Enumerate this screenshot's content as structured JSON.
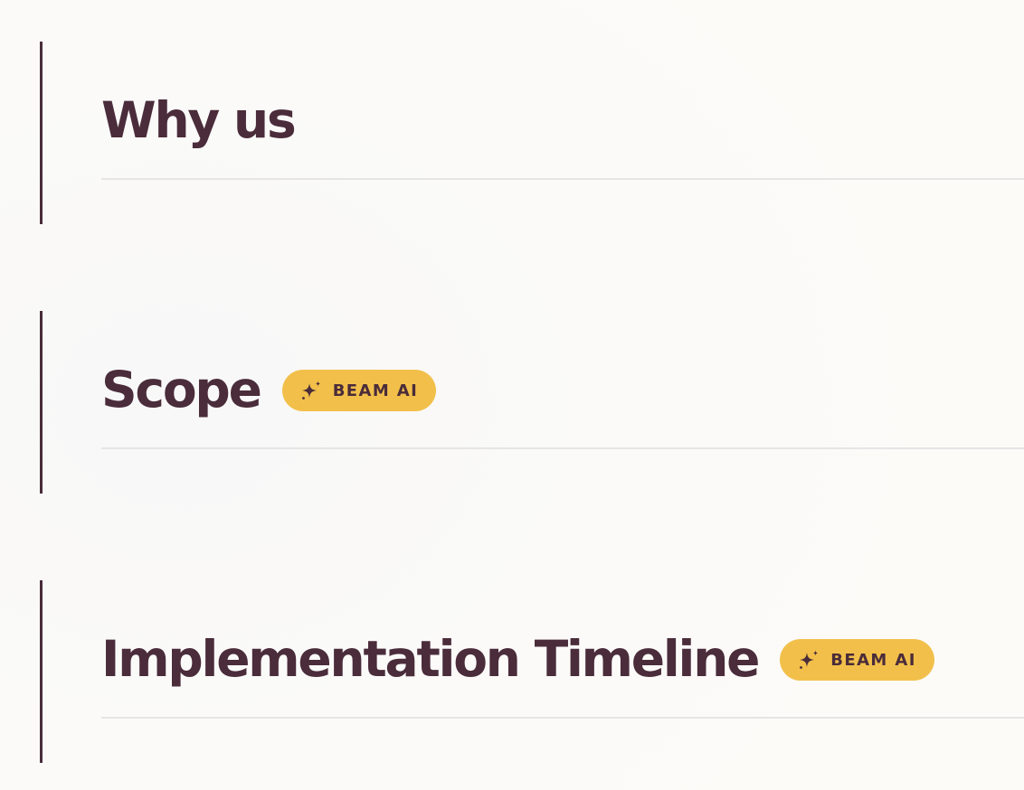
{
  "sections": [
    {
      "title": "Why us",
      "badge": null
    },
    {
      "title": "Scope",
      "badge": {
        "label": "BEAM AI",
        "icon": "sparkle-icon"
      }
    },
    {
      "title": "Implementation Timeline",
      "badge": {
        "label": "BEAM AI",
        "icon": "sparkle-icon"
      }
    }
  ],
  "colors": {
    "heading": "#4a2c3a",
    "accent_bar": "#4a2c3a",
    "badge_bg": "#f2c04a",
    "divider": "#e6e4e4",
    "background": "#fbfaf9"
  }
}
